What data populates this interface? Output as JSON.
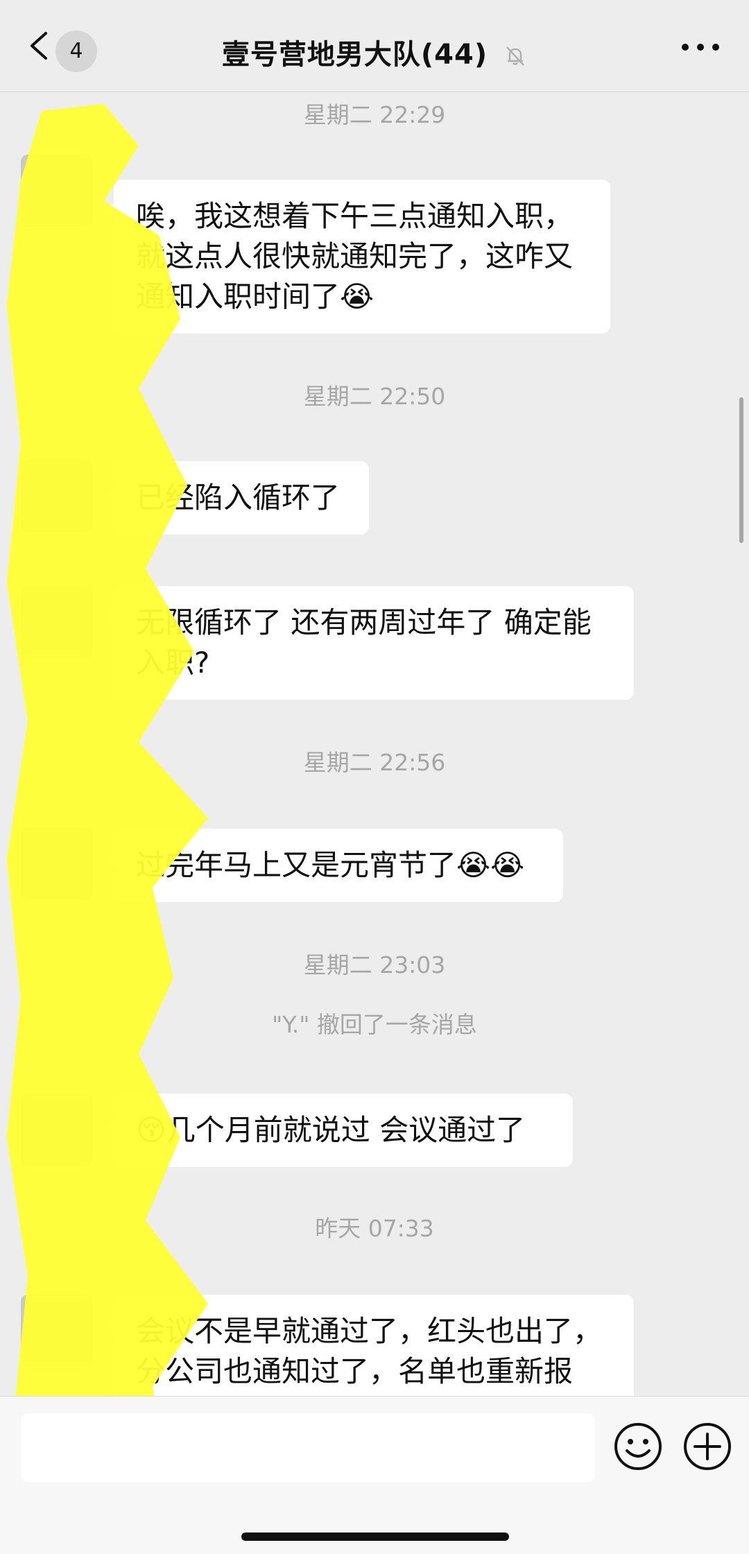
{
  "header": {
    "unread_count": "4",
    "title": "壹号营地男大队(44)",
    "back_icon": "chevron-left-icon",
    "mute_icon": "bell-muted-icon",
    "more_icon": "more-dots-icon"
  },
  "messages": [
    {
      "type": "timestamp",
      "text": "星期二 22:29"
    },
    {
      "type": "bubble",
      "text": "唉，我这想着下午三点通知入职，就这点人很快就通知完了，这咋又通知入职时间了😭"
    },
    {
      "type": "timestamp",
      "text": "星期二 22:50"
    },
    {
      "type": "bubble",
      "text": "已经陷入循环了"
    },
    {
      "type": "bubble",
      "text": "无限循环了  还有两周过年了 确定能入职?"
    },
    {
      "type": "timestamp",
      "text": "星期二 22:56"
    },
    {
      "type": "bubble",
      "text": "过完年马上又是元宵节了😭😭"
    },
    {
      "type": "timestamp",
      "text": "星期二 23:03"
    },
    {
      "type": "system",
      "text": "\"Y.\" 撤回了一条消息"
    },
    {
      "type": "bubble",
      "text": "😚几个月前就说过  会议通过了"
    },
    {
      "type": "timestamp",
      "text": "昨天 07:33"
    },
    {
      "type": "bubble",
      "text": "会议不是早就通过了，红头也出了，分公司也通知过了，名单也重新报"
    }
  ],
  "input_bar": {
    "emoji_icon": "emoji-icon",
    "plus_icon": "plus-circle-icon"
  },
  "colors": {
    "background": "#ededed",
    "bubble": "#ffffff",
    "highlight": "#ffff33"
  }
}
